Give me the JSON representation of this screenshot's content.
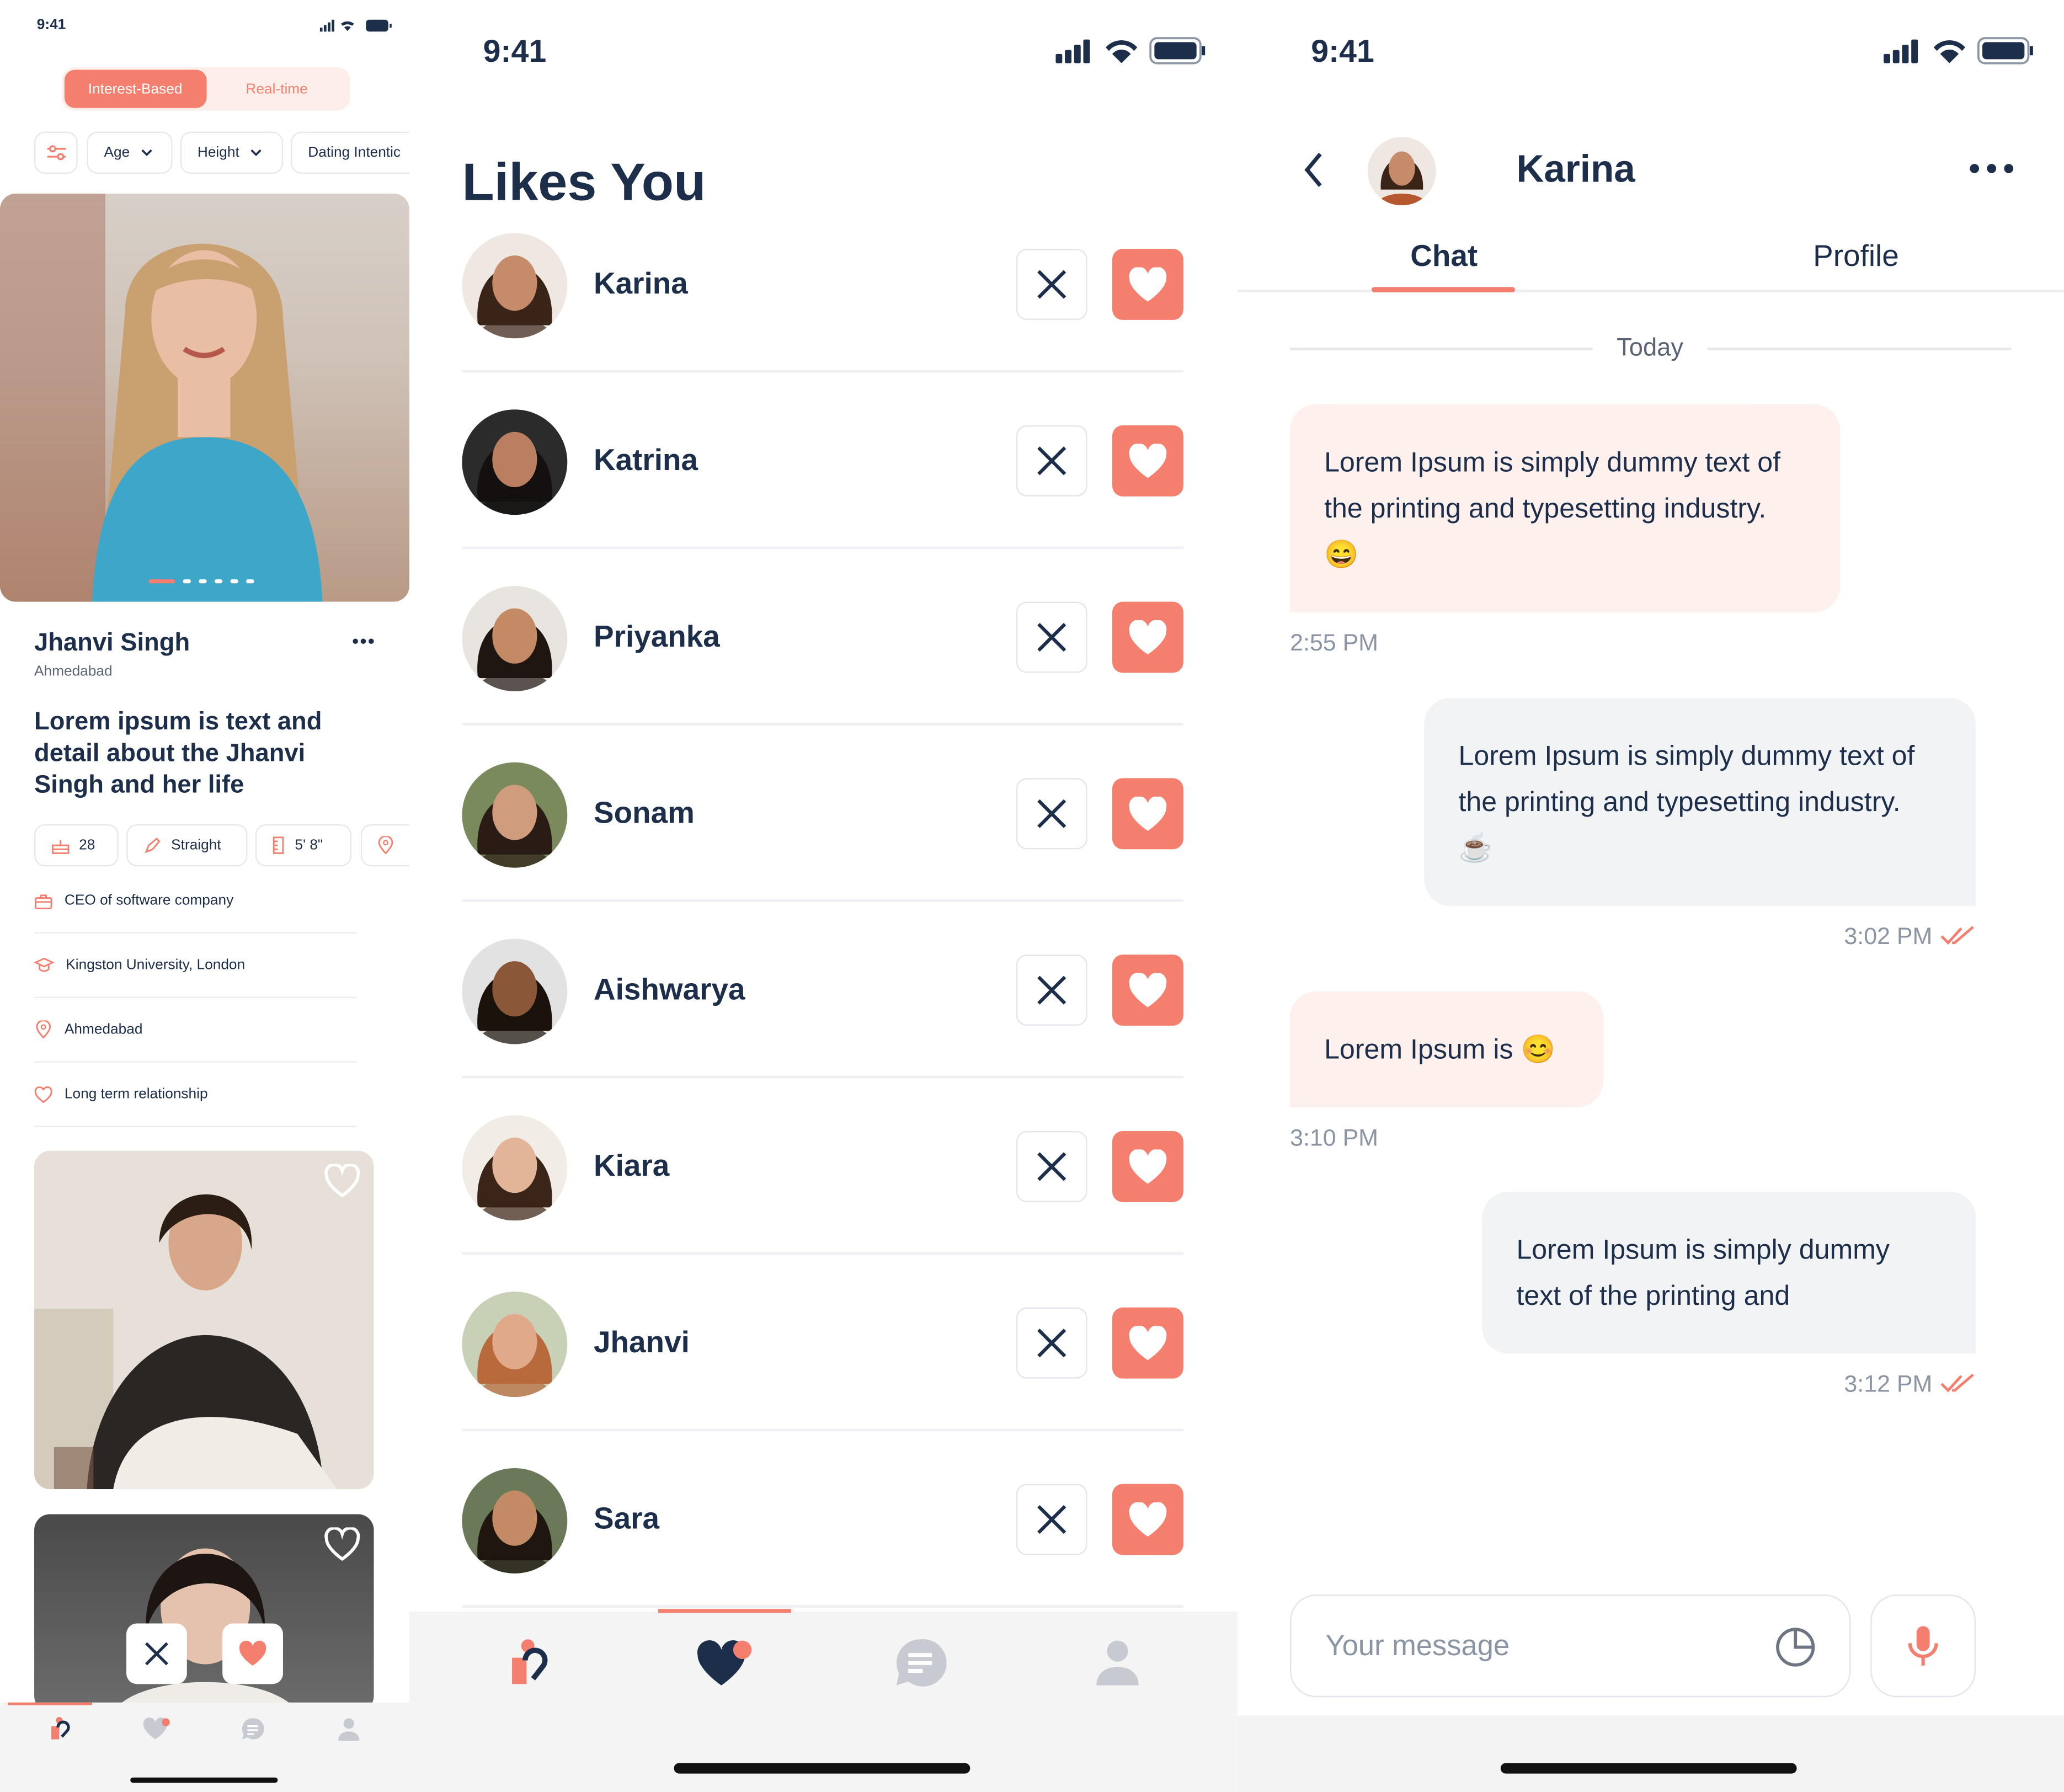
{
  "screen_left": {
    "status_time": "9:41",
    "segment": {
      "active": "Interest-Based",
      "inactive": "Real-time"
    },
    "filters": [
      "Age",
      "Height",
      "Dating Intentic"
    ],
    "profile": {
      "name": "Jhanvi Singh",
      "city": "Ahmedabad",
      "bio": "Lorem ipsum is text and detail about the Jhanvi Singh and her life",
      "pills": [
        "28",
        "Straight",
        "5' 8\""
      ],
      "details": [
        {
          "icon": "briefcase-icon",
          "text": "CEO of software company"
        },
        {
          "icon": "graduation-cap-icon",
          "text": "Kingston University, London"
        },
        {
          "icon": "location-pin-icon",
          "text": "Ahmedabad"
        },
        {
          "icon": "heart-outline-icon",
          "text": "Long term relationship"
        }
      ],
      "carousel_count": 7,
      "carousel_active": 1
    }
  },
  "screen_middle": {
    "status_time": "9:41",
    "title": "Likes You",
    "likes": [
      {
        "name": "Karina",
        "skin": "#c58b6a",
        "hair": "#3a2418",
        "bg": "#efe7e1"
      },
      {
        "name": "Katrina",
        "skin": "#b97f60",
        "hair": "#141010",
        "bg": "#2b2b2b"
      },
      {
        "name": "Priyanka",
        "skin": "#c48a66",
        "hair": "#1f1612",
        "bg": "#e8e4e0"
      },
      {
        "name": "Sonam",
        "skin": "#cf9c7d",
        "hair": "#2a1c14",
        "bg": "#7a8a5c"
      },
      {
        "name": "Aishwarya",
        "skin": "#8a5838",
        "hair": "#1b120c",
        "bg": "#e2e2e2"
      },
      {
        "name": "Kiara",
        "skin": "#e3b598",
        "hair": "#3b2418",
        "bg": "#f1ece6"
      },
      {
        "name": "Jhanvi",
        "skin": "#e0a98a",
        "hair": "#b86a3c",
        "bg": "#c8d1b6"
      },
      {
        "name": "Sara",
        "skin": "#c28b66",
        "hair": "#1f1610",
        "bg": "#6a7a58"
      }
    ]
  },
  "screen_right": {
    "status_time": "9:41",
    "contact_name": "Karina",
    "tabs": [
      "Chat",
      "Profile"
    ],
    "active_tab": "Chat",
    "date_divider": "Today",
    "messages": [
      {
        "dir": "in",
        "text": "Lorem Ipsum is simply dummy text of the printing and typesetting industry. 😄",
        "time": "2:55 PM"
      },
      {
        "dir": "out",
        "text": "Lorem Ipsum is simply dummy text of the printing and typesetting industry. ☕",
        "time": "3:02 PM"
      },
      {
        "dir": "in",
        "text": "Lorem Ipsum is 😊",
        "time": "3:10 PM"
      },
      {
        "dir": "out",
        "text": "Lorem Ipsum is simply dummy text of the printing and",
        "time": "3:12 PM"
      }
    ],
    "input_placeholder": "Your message"
  },
  "colors": {
    "accent": "#f47f6e",
    "navy": "#1c2e4a",
    "muted": "#8b94a3",
    "soft_bg": "#f3f3f3"
  }
}
